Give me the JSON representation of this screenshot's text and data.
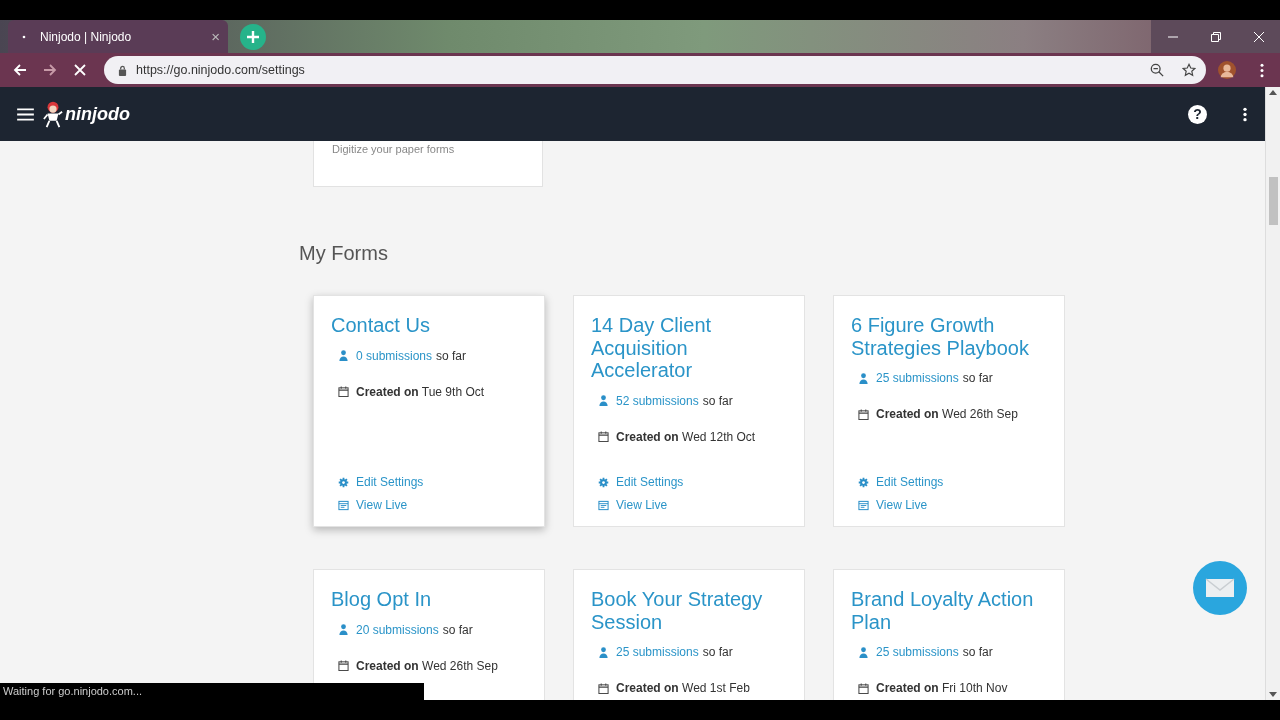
{
  "browser": {
    "tab": {
      "title": "Ninjodo | Ninjodo",
      "close": "×"
    },
    "address": "https://go.ninjodo.com/settings"
  },
  "app": {
    "brand": "ninjodo",
    "help": "?"
  },
  "top_card": {
    "text": "Digitize your paper forms"
  },
  "section_title": "My Forms",
  "forms": [
    {
      "title": "Contact Us",
      "count": "0 submissions",
      "count_suffix": "so far",
      "created_label": "Created on",
      "created_date": "Tue 9th Oct",
      "actions": [
        {
          "kind": "edit",
          "label": "Edit Settings"
        },
        {
          "kind": "view",
          "label": "View Live"
        }
      ]
    },
    {
      "title": "14 Day Client Acquisition Accelerator",
      "count": "52 submissions",
      "count_suffix": "so far",
      "created_label": "Created on",
      "created_date": "Wed 12th Oct",
      "actions": [
        {
          "kind": "edit",
          "label": "Edit Settings"
        },
        {
          "kind": "view",
          "label": "View Live"
        }
      ]
    },
    {
      "title": "6 Figure Growth Strategies Playbook",
      "count": "25 submissions",
      "count_suffix": "so far",
      "created_label": "Created on",
      "created_date": "Wed 26th Sep",
      "actions": [
        {
          "kind": "edit",
          "label": "Edit Settings"
        },
        {
          "kind": "view",
          "label": "View Live"
        }
      ]
    },
    {
      "title": "Blog Opt In",
      "count": "20 submissions",
      "count_suffix": "so far",
      "created_label": "Created on",
      "created_date": "Wed 26th Sep"
    },
    {
      "title": "Book Your Strategy Session",
      "count": "25 submissions",
      "count_suffix": "so far",
      "created_label": "Created on",
      "created_date": "Wed 1st Feb"
    },
    {
      "title": "Brand Loyalty Action Plan",
      "count": "25 submissions",
      "count_suffix": "so far",
      "created_label": "Created on",
      "created_date": "Fri 10th Nov"
    }
  ],
  "status_bar": "Waiting for go.ninjodo.com..."
}
